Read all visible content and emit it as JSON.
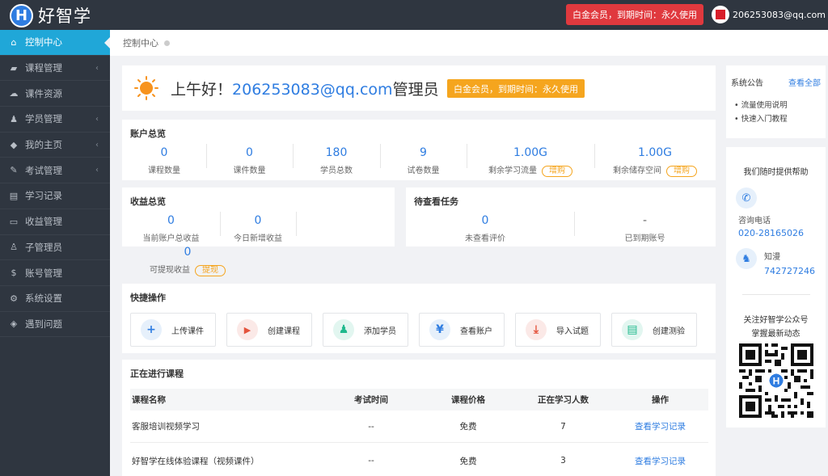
{
  "brand": {
    "logo_letter": "H",
    "name": "好智学"
  },
  "topbar": {
    "vip_status": "白金会员，到期时间：永久使用",
    "user_email": "206253083@qq.com"
  },
  "sidebar": {
    "items": [
      {
        "label": "控制中心",
        "icon": "home-icon",
        "glyph": "⌂",
        "active": true,
        "has_arrow": false
      },
      {
        "label": "课程管理",
        "icon": "book-icon",
        "glyph": "▰",
        "active": false,
        "has_arrow": true
      },
      {
        "label": "课件资源",
        "icon": "cloud-icon",
        "glyph": "☁",
        "active": false,
        "has_arrow": false
      },
      {
        "label": "学员管理",
        "icon": "users-icon",
        "glyph": "♟",
        "active": false,
        "has_arrow": true
      },
      {
        "label": "我的主页",
        "icon": "graduation-cap-icon",
        "glyph": "◆",
        "active": false,
        "has_arrow": true
      },
      {
        "label": "考试管理",
        "icon": "tag-icon",
        "glyph": "✎",
        "active": false,
        "has_arrow": true
      },
      {
        "label": "学习记录",
        "icon": "notebook-icon",
        "glyph": "▤",
        "active": false,
        "has_arrow": false
      },
      {
        "label": "收益管理",
        "icon": "credit-card-icon",
        "glyph": "▭",
        "active": false,
        "has_arrow": false
      },
      {
        "label": "子管理员",
        "icon": "user-icon",
        "glyph": "♙",
        "active": false,
        "has_arrow": false
      },
      {
        "label": "账号管理",
        "icon": "dollar-icon",
        "glyph": "$",
        "active": false,
        "has_arrow": false
      },
      {
        "label": "系统设置",
        "icon": "gear-icon",
        "glyph": "⚙",
        "active": false,
        "has_arrow": false
      },
      {
        "label": "遇到问题",
        "icon": "tag-icon",
        "glyph": "◈",
        "active": false,
        "has_arrow": false
      }
    ],
    "arrow_glyph": "‹"
  },
  "breadcrumb": {
    "current": "控制中心"
  },
  "greeting": {
    "prefix": "上午好！",
    "username": "206253083@qq.com",
    "role": "管理员",
    "vip_badge": "白金会员，到期时间：永久使用"
  },
  "account_overview": {
    "title": "账户总览",
    "stats": [
      {
        "value": "0",
        "label": "课程数量"
      },
      {
        "value": "0",
        "label": "课件数量"
      },
      {
        "value": "180",
        "label": "学员总数"
      },
      {
        "value": "9",
        "label": "试卷数量"
      },
      {
        "value": "1.00G",
        "label": "剩余学习流量",
        "action": "增购"
      },
      {
        "value": "1.00G",
        "label": "剩余储存空间",
        "action": "增购"
      }
    ]
  },
  "income_overview": {
    "title": "收益总览",
    "stats": [
      {
        "value": "0",
        "label": "当前账户总收益"
      },
      {
        "value": "0",
        "label": "今日新增收益"
      },
      {
        "value": "0",
        "label": "可提现收益",
        "action": "提现"
      }
    ]
  },
  "pending_tasks": {
    "title": "待查看任务",
    "stats": [
      {
        "value": "0",
        "label": "未查看评价"
      },
      {
        "value": "-",
        "label": "已到期账号"
      }
    ]
  },
  "quick_actions": {
    "title": "快捷操作",
    "items": [
      {
        "label": "上传课件",
        "icon": "plus-icon",
        "glyph": "+",
        "bg": "#e6f0fb",
        "fg": "#2f7de1"
      },
      {
        "label": "创建课程",
        "icon": "video-icon",
        "glyph": "▶",
        "bg": "#fbe9e7",
        "fg": "#e4533c"
      },
      {
        "label": "添加学员",
        "icon": "user-add-icon",
        "glyph": "♟",
        "bg": "#e2f6f0",
        "fg": "#1fb98d"
      },
      {
        "label": "查看账户",
        "icon": "yen-icon",
        "glyph": "¥",
        "bg": "#e6f0fb",
        "fg": "#2f7de1"
      },
      {
        "label": "导入试题",
        "icon": "download-icon",
        "glyph": "⤓",
        "bg": "#fbe9e7",
        "fg": "#e4533c"
      },
      {
        "label": "创建测验",
        "icon": "document-icon",
        "glyph": "▤",
        "bg": "#e2f6f0",
        "fg": "#1fb98d"
      }
    ]
  },
  "courses": {
    "title": "正在进行课程",
    "columns": [
      "课程名称",
      "考试时间",
      "课程价格",
      "正在学习人数",
      "操作"
    ],
    "rows": [
      {
        "name": "客服培训视频学习",
        "exam_time": "--",
        "price": "免费",
        "learners": "7",
        "action": "查看学习记录"
      },
      {
        "name": "好智学在线体验课程（视频课件）",
        "exam_time": "--",
        "price": "免费",
        "learners": "3",
        "action": "查看学习记录"
      }
    ]
  },
  "notice": {
    "title": "系统公告",
    "view_all": "查看全部",
    "items": [
      "流量使用说明",
      "快速入门教程"
    ]
  },
  "help": {
    "title": "我们随时提供帮助",
    "phone_label": "咨询电话",
    "phone": "020-28165026",
    "qq_label": "知漫",
    "qq": "742727246",
    "follow_line1": "关注好智学公众号",
    "follow_line2": "掌握最新动态",
    "qr_logo": "H"
  },
  "colors": {
    "accent": "#20a7d8",
    "link": "#2f7de1",
    "vip_red": "#e0393e",
    "vip_orange": "#f5a51e",
    "sidebar_bg": "#2f3640"
  }
}
